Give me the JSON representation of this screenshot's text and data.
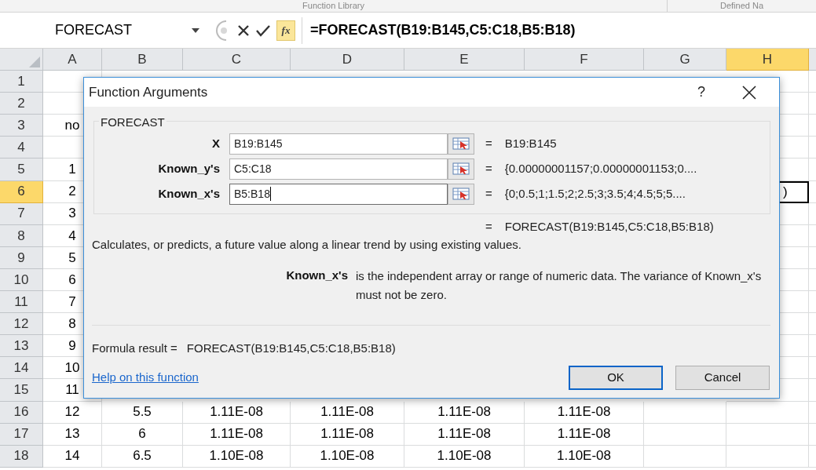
{
  "ribbon_groups": [
    "Function Library",
    "Defined Na"
  ],
  "formula_bar": {
    "name_box": "FORECAST",
    "fx": "fx",
    "formula": "=FORECAST(B19:B145,C5:C18,B5:B18)"
  },
  "columns": [
    {
      "label": "A",
      "selected": false
    },
    {
      "label": "B",
      "selected": false
    },
    {
      "label": "C",
      "selected": false
    },
    {
      "label": "D",
      "selected": false
    },
    {
      "label": "E",
      "selected": false
    },
    {
      "label": "F",
      "selected": false
    },
    {
      "label": "G",
      "selected": false
    },
    {
      "label": "H",
      "selected": true
    }
  ],
  "rows": [
    {
      "label": "1",
      "selected": false
    },
    {
      "label": "2",
      "selected": false
    },
    {
      "label": "3",
      "selected": false,
      "cells": {
        "A": {
          "text": "no",
          "active": false
        }
      }
    },
    {
      "label": "4",
      "selected": false
    },
    {
      "label": "5",
      "selected": false,
      "cells": {
        "A": {
          "text": "1",
          "active": false
        }
      }
    },
    {
      "label": "6",
      "selected": true,
      "cells": {
        "A": {
          "text": "2",
          "active": false
        },
        "H": {
          "text": ")",
          "active": true
        }
      }
    },
    {
      "label": "7",
      "selected": false,
      "cells": {
        "A": {
          "text": "3",
          "active": false
        }
      }
    },
    {
      "label": "8",
      "selected": false,
      "cells": {
        "A": {
          "text": "4",
          "active": false
        }
      }
    },
    {
      "label": "9",
      "selected": false,
      "cells": {
        "A": {
          "text": "5",
          "active": false
        }
      }
    },
    {
      "label": "10",
      "selected": false,
      "cells": {
        "A": {
          "text": "6",
          "active": false
        }
      }
    },
    {
      "label": "11",
      "selected": false,
      "cells": {
        "A": {
          "text": "7",
          "active": false
        }
      }
    },
    {
      "label": "12",
      "selected": false,
      "cells": {
        "A": {
          "text": "8",
          "active": false
        }
      }
    },
    {
      "label": "13",
      "selected": false,
      "cells": {
        "A": {
          "text": "9",
          "active": false
        }
      }
    },
    {
      "label": "14",
      "selected": false,
      "cells": {
        "A": {
          "text": "10",
          "active": false
        }
      }
    },
    {
      "label": "15",
      "selected": false,
      "cells": {
        "A": {
          "text": "11",
          "active": false
        }
      }
    },
    {
      "label": "16",
      "selected": false,
      "cells": {
        "A": {
          "text": "12",
          "active": false
        },
        "B": {
          "text": "5.5",
          "active": false
        },
        "C": {
          "text": "1.11E-08",
          "active": false
        },
        "D": {
          "text": "1.11E-08",
          "active": false
        },
        "E": {
          "text": "1.11E-08",
          "active": false
        },
        "F": {
          "text": "1.11E-08",
          "active": false
        }
      }
    },
    {
      "label": "17",
      "selected": false,
      "cells": {
        "A": {
          "text": "13",
          "active": false
        },
        "B": {
          "text": "6",
          "active": false
        },
        "C": {
          "text": "1.11E-08",
          "active": false
        },
        "D": {
          "text": "1.11E-08",
          "active": false
        },
        "E": {
          "text": "1.11E-08",
          "active": false
        },
        "F": {
          "text": "1.11E-08",
          "active": false
        }
      }
    },
    {
      "label": "18",
      "selected": false,
      "cells": {
        "A": {
          "text": "14",
          "active": false
        },
        "B": {
          "text": "6.5",
          "active": false
        },
        "C": {
          "text": "1.10E-08",
          "active": false
        },
        "D": {
          "text": "1.10E-08",
          "active": false
        },
        "E": {
          "text": "1.10E-08",
          "active": false
        },
        "F": {
          "text": "1.10E-08",
          "active": false
        }
      }
    }
  ],
  "dialog": {
    "title": "Function Arguments",
    "help": "?",
    "group": "FORECAST",
    "arguments": [
      {
        "label": "X",
        "value": "B19:B145",
        "equals": "=",
        "result": "B19:B145",
        "focused": false
      },
      {
        "label": "Known_y's",
        "value": "C5:C18",
        "equals": "=",
        "result": "{0.00000001157;0.00000001153;0....",
        "focused": false
      },
      {
        "label": "Known_x's",
        "value": "B5:B18",
        "equals": "=",
        "result": "{0;0.5;1;1.5;2;2.5;3;3.5;4;4.5;5;5....",
        "focused": true
      }
    ],
    "result_equals": "=",
    "result": "FORECAST(B19:B145,C5:C18,B5:B18)",
    "description": "Calculates, or predicts, a future value along a linear trend by using existing values.",
    "argument_help": {
      "name": "Known_x's",
      "text": "is the independent array or range of numeric data. The variance of Known_x's must not be zero."
    },
    "formula_result_label": "Formula result =",
    "formula_result": "FORECAST(B19:B145,C5:C18,B5:B18)",
    "help_link": "Help on this function",
    "buttons": [
      {
        "label": "OK",
        "default": true
      },
      {
        "label": "Cancel",
        "default": false
      }
    ]
  }
}
